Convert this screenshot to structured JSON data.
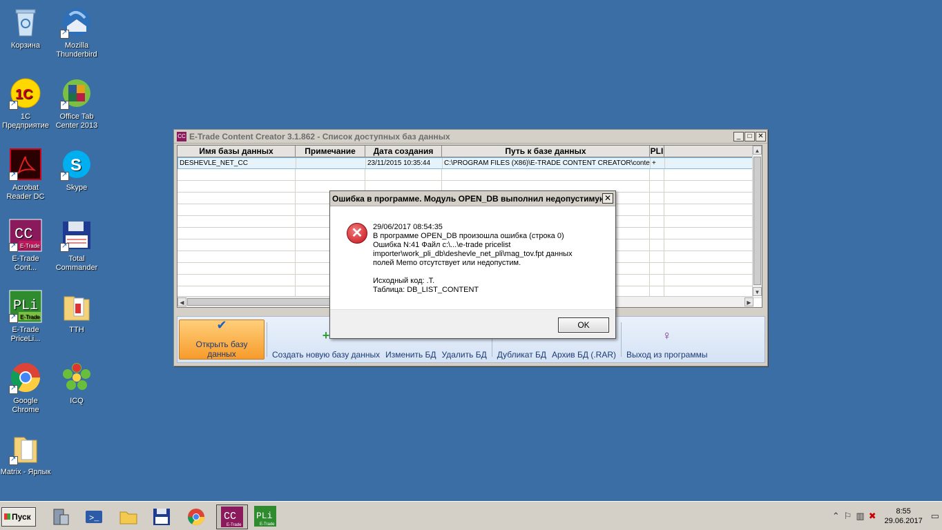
{
  "desktop": {
    "icons": [
      {
        "label": "Корзина"
      },
      {
        "label": "Mozilla Thunderbird"
      },
      {
        "label": "1С Предприятие"
      },
      {
        "label": "Office Tab Center 2013"
      },
      {
        "label": "Acrobat Reader DC"
      },
      {
        "label": "Skype"
      },
      {
        "label": "E-Trade Cont..."
      },
      {
        "label": "Total Commander"
      },
      {
        "label": "E-Trade PriceLi..."
      },
      {
        "label": "TTH"
      },
      {
        "label": "Google Chrome"
      },
      {
        "label": "ICQ"
      },
      {
        "label": "Matrix - Ярлык"
      }
    ]
  },
  "window": {
    "app_icon_text": "CC",
    "title": "E-Trade Content Creator 3.1.862 - Список доступных баз данных",
    "columns": [
      "Имя базы данных",
      "Примечание",
      "Дата создания",
      "Путь к базе данных",
      "PLI"
    ],
    "rows": [
      {
        "name": "DESHEVLE_NET_CC",
        "note": "",
        "created": "23/11/2015 10:35:44",
        "path": "C:\\PROGRAM FILES (X86)\\E-TRADE CONTENT CREATOR\\conte",
        "pli": "+"
      }
    ],
    "toolbar": {
      "open": "Открыть базу данных",
      "create": "Создать новую базу данных",
      "edit": "Изменить БД",
      "delete": "Удалить БД",
      "duplicate": "Дубликат БД",
      "archive": "Архив БД (.RAR)",
      "exit": "Выход из программы"
    }
  },
  "dialog": {
    "title": "Ошибка в программе. Модуль OPEN_DB выполнил недопустимую...",
    "close": "✕",
    "lines": [
      "29/06/2017 08:54:35",
      "В программе OPEN_DB произошла ошибка (строка 0)",
      "Ошибка N:41 Файл c:\\...\\e-trade pricelist",
      "importer\\work_pli_db\\deshevle_net_pli\\mag_tov.fpt данных",
      "полей Memo отсутствует или недопустим."
    ],
    "source_code": "Исходный код: .T.",
    "table": "Таблица: DB_LIST_CONTENT",
    "ok": "OK"
  },
  "taskbar": {
    "start": "Пуск",
    "time": "8:55",
    "date": "29.06.2017"
  }
}
